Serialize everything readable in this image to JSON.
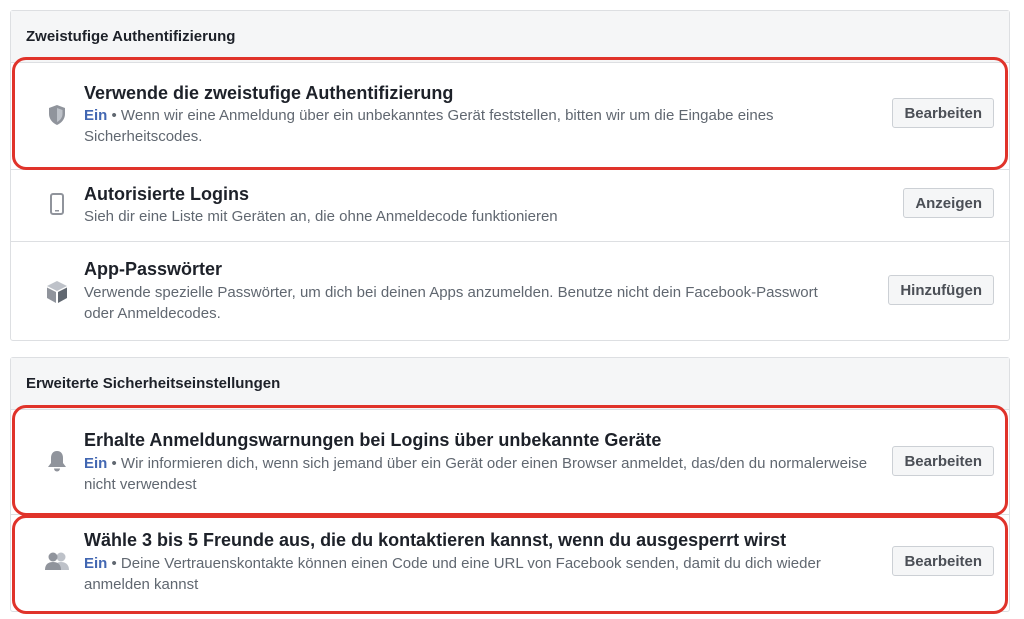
{
  "two_factor_section": {
    "header": "Zweistufige Authentifizierung",
    "rows": [
      {
        "title": "Verwende die zweistufige Authentifizierung",
        "status": "Ein",
        "description": " • Wenn wir eine Anmeldung über ein unbekanntes Gerät feststellen, bitten wir um die Eingabe eines Sicherheitscodes.",
        "button": "Bearbeiten",
        "icon": "shield-icon"
      },
      {
        "title": "Autorisierte Logins",
        "description": "Sieh dir eine Liste mit Geräten an, die ohne Anmeldecode funktionieren",
        "button": "Anzeigen",
        "icon": "phone-icon"
      },
      {
        "title": "App-Passwörter",
        "description": "Verwende spezielle Passwörter, um dich bei deinen Apps anzumelden. Benutze nicht dein Facebook-Passwort oder Anmeldecodes.",
        "button": "Hinzufügen",
        "icon": "cube-icon"
      }
    ]
  },
  "advanced_section": {
    "header": "Erweiterte Sicherheitseinstellungen",
    "rows": [
      {
        "title": "Erhalte Anmeldungswarnungen bei Logins über unbekannte Geräte",
        "status": "Ein",
        "description": " • Wir informieren dich, wenn sich jemand über ein Gerät oder einen Browser anmeldet, das/den du normalerweise nicht verwendest",
        "button": "Bearbeiten",
        "icon": "bell-icon"
      },
      {
        "title": "Wähle 3 bis 5 Freunde aus, die du kontaktieren kannst, wenn du ausgesperrt wirst",
        "status": "Ein",
        "description": " • Deine Vertrauenskontakte können einen Code und eine URL von Facebook senden, damit du dich wieder anmelden kannst",
        "button": "Bearbeiten",
        "icon": "friends-icon"
      }
    ]
  },
  "colors": {
    "highlight": "#e0332a",
    "status_blue": "#4267b2",
    "header_bg": "#f5f6f7",
    "border": "#dddfe2"
  }
}
